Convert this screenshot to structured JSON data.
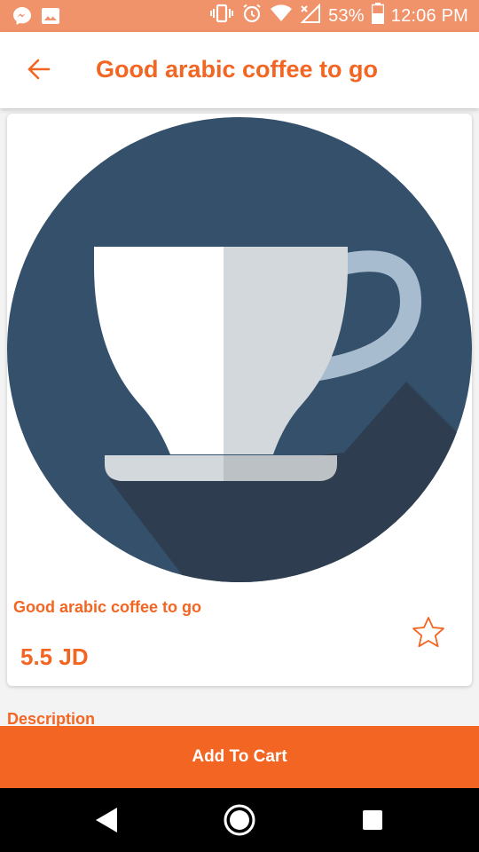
{
  "status_bar": {
    "left_icons": [
      "messenger-icon",
      "image-icon"
    ],
    "battery_text": "53%",
    "time": "12:06 PM"
  },
  "app_bar": {
    "title": "Good arabic coffee to go"
  },
  "product": {
    "name": "Good arabic coffee to go",
    "price": "5.5 JD",
    "image": "coffee-cup-icon"
  },
  "description_label": "Description",
  "actions": {
    "add_to_cart": "Add To Cart"
  },
  "colors": {
    "accent": "#f26522",
    "status_bar": "#f0926a",
    "circle": "#34506a",
    "shadow": "#2e3e50",
    "cup_light": "#d3d8dd"
  }
}
